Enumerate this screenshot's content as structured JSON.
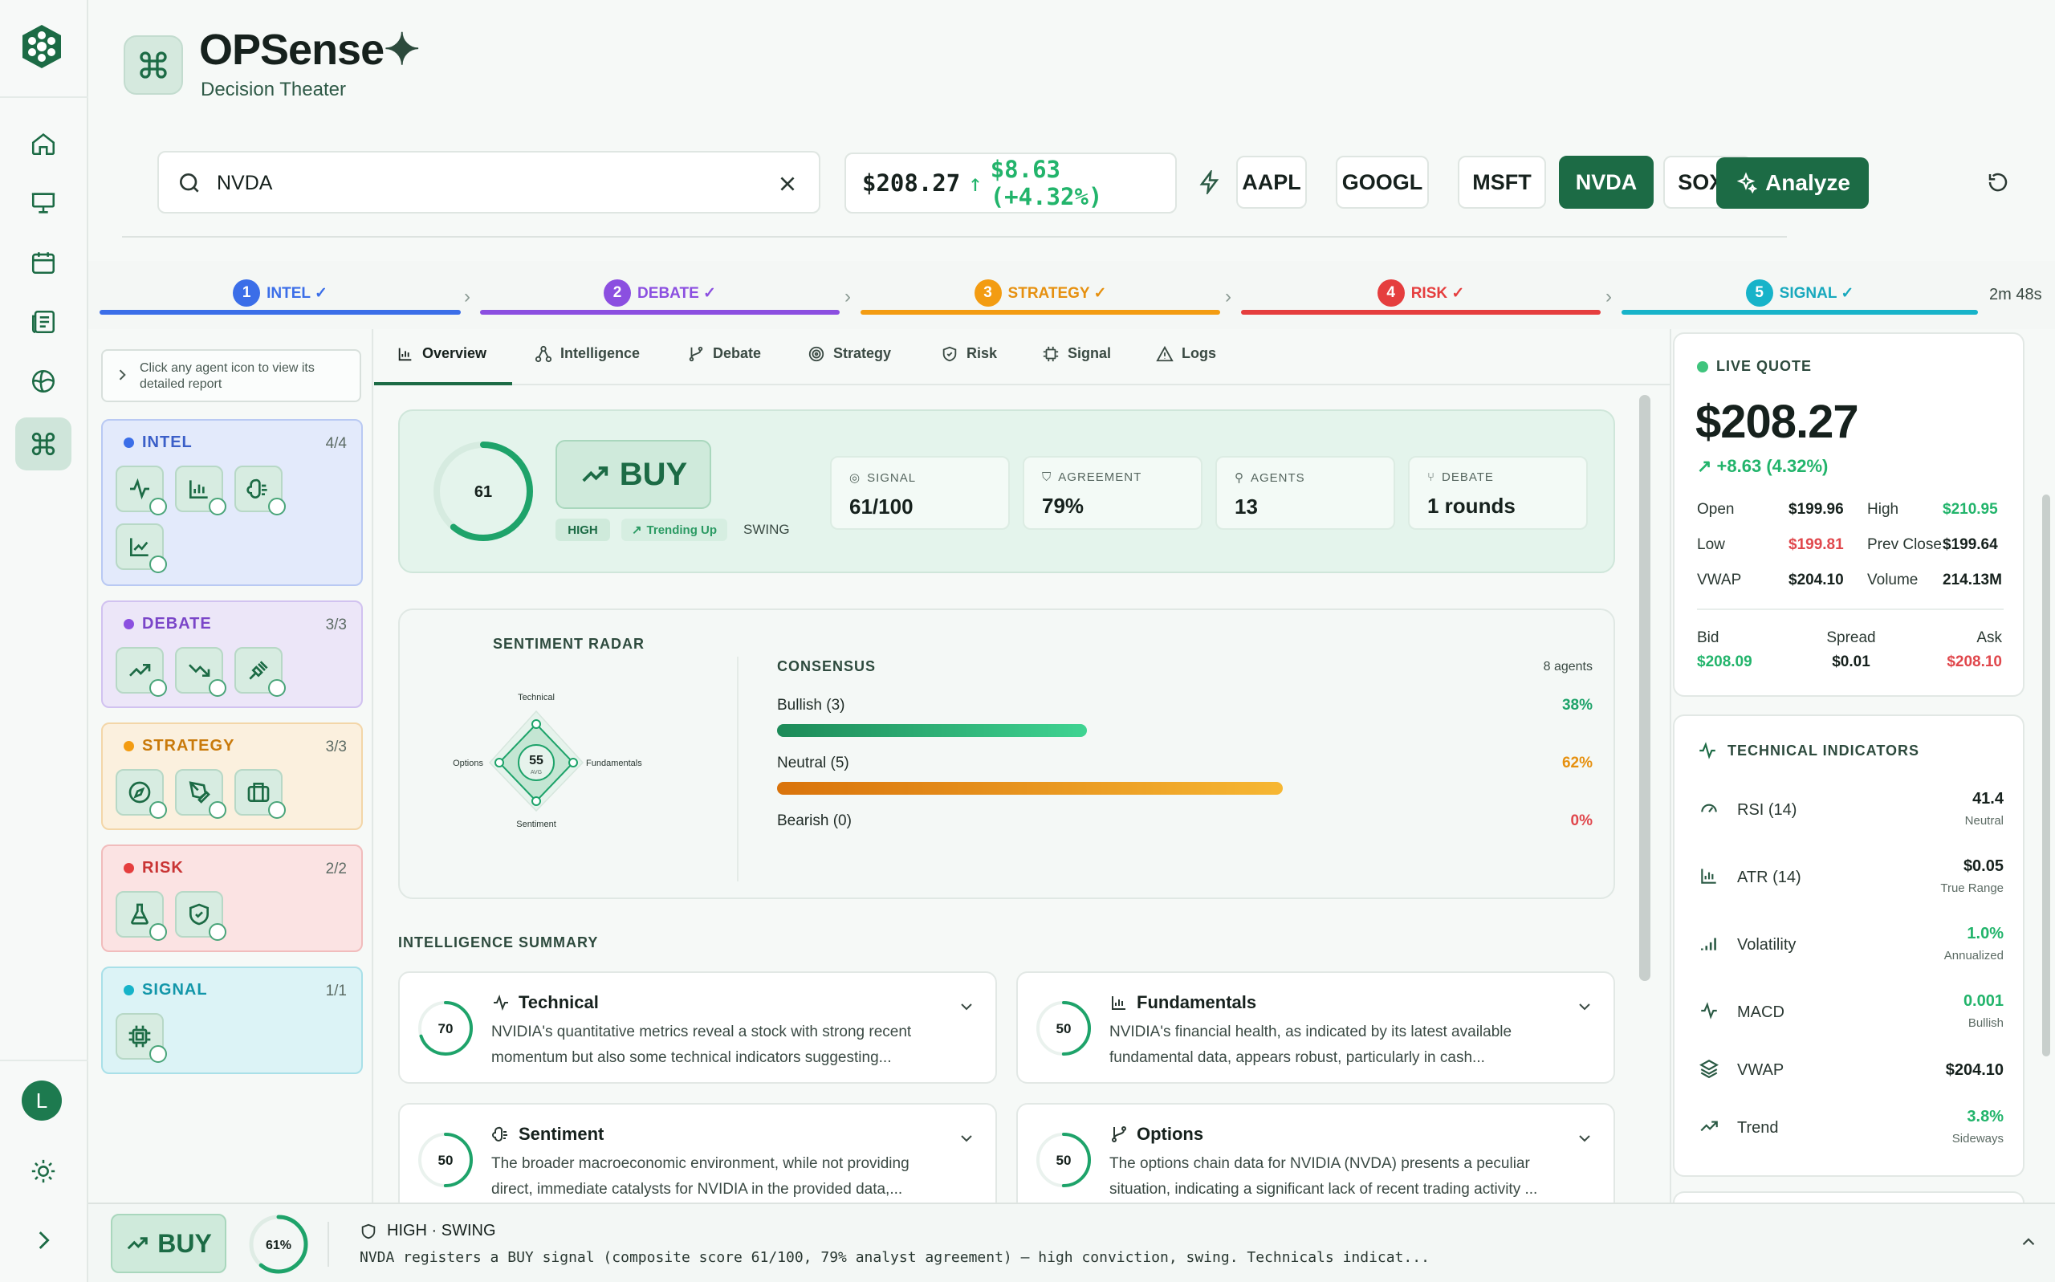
{
  "app": {
    "title": "OPSense",
    "title_mark": "✦",
    "subtitle": "Decision Theater"
  },
  "colors": {
    "accent": "#1c6b45",
    "green": "#22b46b",
    "red": "#e0474c",
    "intel": "#3b6ee8",
    "debate": "#8b4fe0",
    "strategy": "#f39c12",
    "risk": "#e53e3e",
    "signal": "#17b3c9"
  },
  "sidebar_nav": [
    {
      "icon": "home-icon"
    },
    {
      "icon": "presentation-icon"
    },
    {
      "icon": "calendar-icon"
    },
    {
      "icon": "newspaper-icon"
    },
    {
      "icon": "globe-icon"
    },
    {
      "icon": "command-icon",
      "active": true
    }
  ],
  "user": {
    "initial": "L"
  },
  "search": {
    "value": "NVDA"
  },
  "price_box": {
    "price": "$208.27",
    "change": "$8.63 (+4.32%)"
  },
  "tickers": [
    "AAPL",
    "GOOGL",
    "MSFT",
    "NVDA",
    "SOXL"
  ],
  "selected_ticker": "NVDA",
  "analyze_label": "Analyze",
  "pipeline": {
    "steps": [
      {
        "num": "1",
        "label": "INTEL ✓"
      },
      {
        "num": "2",
        "label": "DEBATE ✓"
      },
      {
        "num": "3",
        "label": "STRATEGY ✓"
      },
      {
        "num": "4",
        "label": "RISK ✓"
      },
      {
        "num": "5",
        "label": "SIGNAL ✓"
      }
    ],
    "elapsed": "2m 48s"
  },
  "left_panel": {
    "hint": "Click any agent icon to view its detailed report",
    "groups": [
      {
        "name": "INTEL",
        "count": "4/4"
      },
      {
        "name": "DEBATE",
        "count": "3/3"
      },
      {
        "name": "STRATEGY",
        "count": "3/3"
      },
      {
        "name": "RISK",
        "count": "2/2"
      },
      {
        "name": "SIGNAL",
        "count": "1/1"
      }
    ]
  },
  "tabs": [
    "Overview",
    "Intelligence",
    "Debate",
    "Strategy",
    "Risk",
    "Signal",
    "Logs"
  ],
  "active_tab": "Overview",
  "signal_card": {
    "score": "61",
    "score_fraction": 0.61,
    "action": "BUY",
    "conviction": "HIGH",
    "trend": "Trending Up",
    "horizon": "SWING",
    "metrics": [
      {
        "label": "SIGNAL",
        "value": "61/100"
      },
      {
        "label": "AGREEMENT",
        "value": "79%"
      },
      {
        "label": "AGENTS",
        "value": "13"
      },
      {
        "label": "DEBATE",
        "value": "1 rounds"
      }
    ]
  },
  "radar": {
    "title": "SENTIMENT RADAR",
    "axes": {
      "top": "Technical",
      "right": "Fundamentals",
      "bottom": "Sentiment",
      "left": "Options"
    },
    "avg_value": "55",
    "avg_label": "AVG"
  },
  "consensus": {
    "title": "CONSENSUS",
    "agents": "8 agents",
    "rows": [
      {
        "label": "Bullish (3)",
        "pct": "38%",
        "fraction": 0.38
      },
      {
        "label": "Neutral (5)",
        "pct": "62%",
        "fraction": 0.62
      },
      {
        "label": "Bearish (0)",
        "pct": "0%",
        "fraction": 0
      }
    ]
  },
  "intelligence": {
    "title": "INTELLIGENCE SUMMARY",
    "cards": [
      {
        "title": "Technical",
        "score": "70",
        "icon": "activity-icon",
        "text": "NVIDIA's quantitative metrics reveal a stock with strong recent momentum but also some technical indicators suggesting..."
      },
      {
        "title": "Fundamentals",
        "score": "50",
        "icon": "bar-chart-icon",
        "text": "NVIDIA's financial health, as indicated by its latest available fundamental data, appears robust, particularly in cash..."
      },
      {
        "title": "Sentiment",
        "score": "50",
        "icon": "brain-icon",
        "text": "The broader macroeconomic environment, while not providing direct, immediate catalysts for NVIDIA in the provided data,..."
      },
      {
        "title": "Options",
        "score": "50",
        "icon": "git-branch-icon",
        "text": "The options chain data for NVIDIA (NVDA) presents a peculiar situation, indicating a significant lack of recent trading activity ..."
      }
    ]
  },
  "quote": {
    "title": "LIVE QUOTE",
    "price": "$208.27",
    "change": "+8.63 (4.32%)",
    "open_label": "Open",
    "open": "$199.96",
    "high_label": "High",
    "high": "$210.95",
    "low_label": "Low",
    "low": "$199.81",
    "prev_label": "Prev Close",
    "prev": "$199.64",
    "vwap_label": "VWAP",
    "vwap": "$204.10",
    "vol_label": "Volume",
    "volume": "214.13M",
    "bid_label": "Bid",
    "bid": "$208.09",
    "spread_label": "Spread",
    "spread": "$0.01",
    "ask_label": "Ask",
    "ask": "$208.10"
  },
  "technicals": {
    "title": "TECHNICAL INDICATORS",
    "rows": [
      {
        "name": "RSI (14)",
        "value": "41.4",
        "sub": "Neutral",
        "icon": "gauge-icon"
      },
      {
        "name": "ATR (14)",
        "value": "$0.05",
        "sub": "True Range",
        "icon": "bar-chart-icon"
      },
      {
        "name": "Volatility",
        "value": "1.0%",
        "sub": "Annualized",
        "icon": "signal-bars-icon"
      },
      {
        "name": "MACD",
        "value": "0.001",
        "sub": "Bullish",
        "icon": "activity-icon"
      },
      {
        "name": "VWAP",
        "value": "$204.10",
        "sub": "",
        "icon": "layers-icon"
      },
      {
        "name": "Trend",
        "value": "3.8%",
        "sub": "Sideways",
        "icon": "trending-up-icon"
      }
    ]
  },
  "footer": {
    "action": "BUY",
    "confidence": "61%",
    "confidence_fraction": 0.61,
    "tag": "HIGH · SWING",
    "summary": "NVDA registers a BUY signal (composite score 61/100, 79% analyst agreement) — high conviction, swing. Technicals indicat..."
  }
}
